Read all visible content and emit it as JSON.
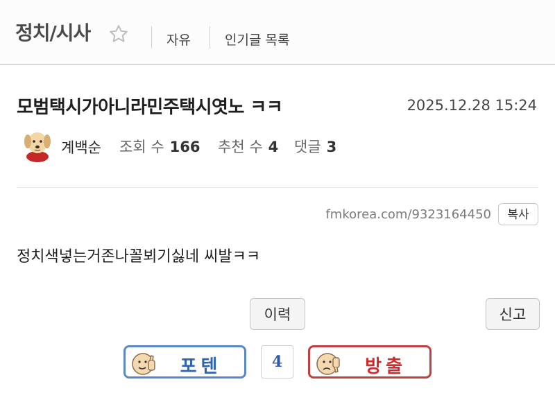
{
  "header": {
    "board_title": "정치/시사",
    "nav": [
      "자유",
      "인기글 목록"
    ]
  },
  "post": {
    "title": "모범택시가아니라민주택시엿노 ㅋㅋ",
    "datetime": "2025.12.28 15:24",
    "author": "계백순",
    "stats": {
      "views_label": "조회 수",
      "views": "166",
      "recommend_label": "추천 수",
      "recommends": "4",
      "comments_label": "댓글",
      "comments": "3"
    },
    "url": "fmkorea.com/9323164450",
    "copy_label": "복사",
    "content": "정치색넣는거존나꼴뵈기싫네 씨발ㅋㅋ"
  },
  "actions": {
    "history_label": "이력",
    "report_label": "신고"
  },
  "votes": {
    "up_label": "포텐",
    "count": "4",
    "down_label": "방출",
    "up_color": "#2f64b3",
    "down_color": "#d22a2a"
  }
}
